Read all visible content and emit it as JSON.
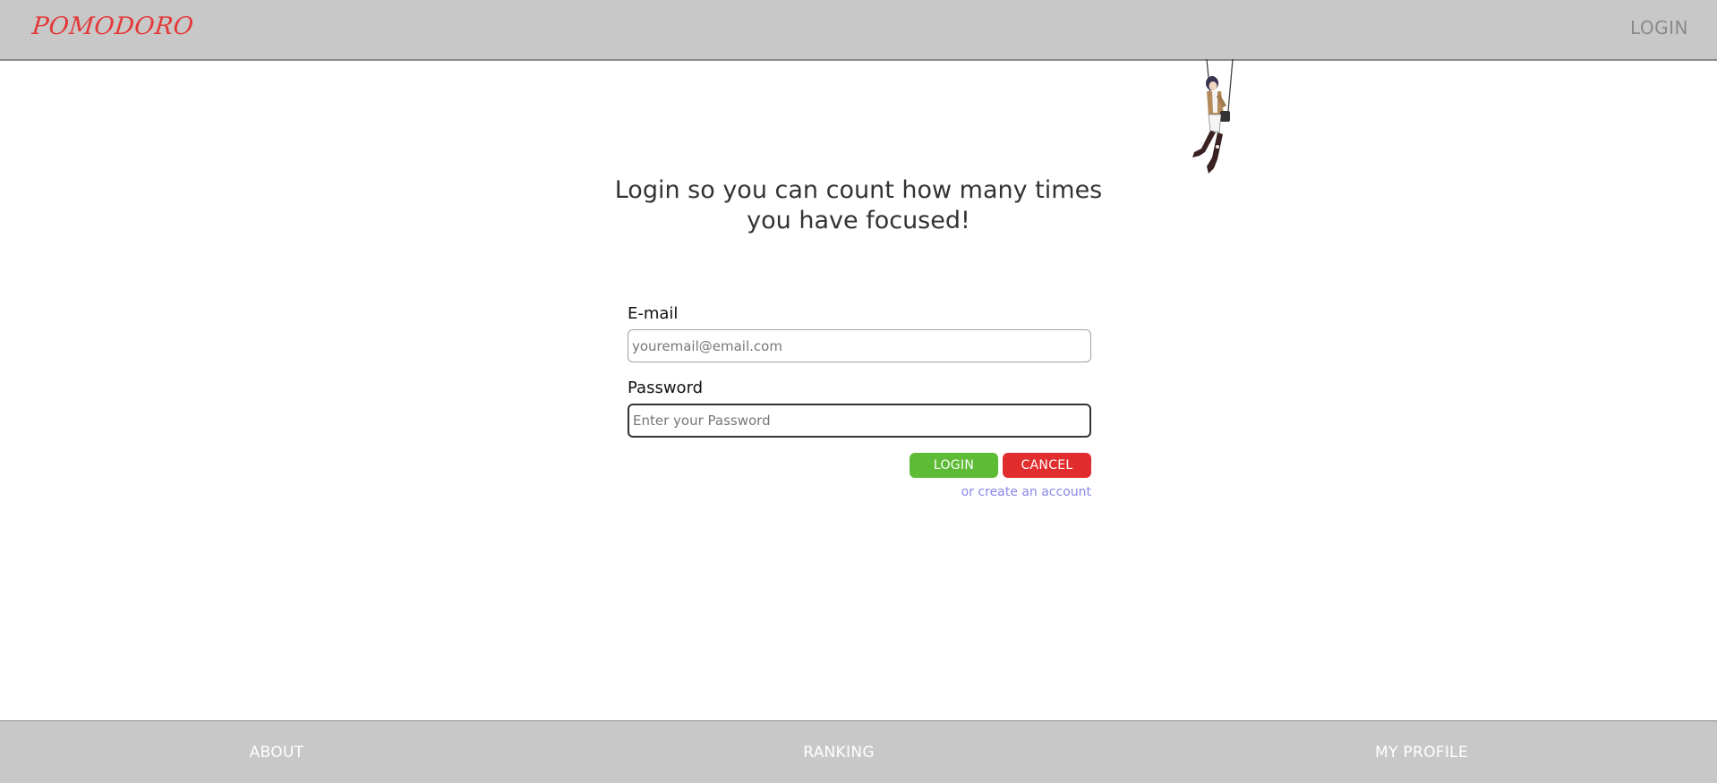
{
  "header": {
    "brand": "POMODORO",
    "login_link": "LOGIN"
  },
  "main": {
    "headline": "Login so you can count how many times you have focused!",
    "form": {
      "email_label": "E-mail",
      "email_placeholder": "youremail@email.com",
      "email_value": "",
      "password_label": "Password",
      "password_placeholder": "Enter your Password",
      "password_value": "",
      "login_button": "LOGIN",
      "cancel_button": "CANCEL",
      "create_account_link": "or create an account"
    }
  },
  "footer": {
    "about": "ABOUT",
    "ranking": "RANKING",
    "my_profile": "MY PROFILE"
  },
  "colors": {
    "bar_background": "#c8c8c8",
    "brand": "#e43838",
    "login_button": "#5dbb35",
    "cancel_button": "#e12d2d",
    "link": "#8a87e6"
  },
  "icons": {
    "decoration": "hanging-character-illustration"
  }
}
